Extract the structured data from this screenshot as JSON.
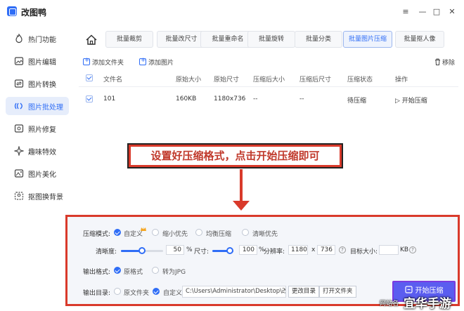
{
  "app": {
    "title": "改图鸭"
  },
  "window": {
    "menu_icon": "≡",
    "minimize_icon": "—",
    "maximize_icon": "□",
    "close_icon": "✕"
  },
  "sidebar": {
    "items": [
      {
        "label": "热门功能",
        "icon": "flame-icon"
      },
      {
        "label": "图片编辑",
        "icon": "image-edit-icon"
      },
      {
        "label": "图片转换",
        "icon": "convert-icon"
      },
      {
        "label": "图片批处理",
        "icon": "batch-icon"
      },
      {
        "label": "照片修复",
        "icon": "repair-icon"
      },
      {
        "label": "趣味特效",
        "icon": "effects-icon"
      },
      {
        "label": "图片美化",
        "icon": "beautify-icon"
      },
      {
        "label": "抠图换背景",
        "icon": "cutout-icon"
      }
    ],
    "active_index": 3
  },
  "tabs": [
    "批量裁剪",
    "批量改尺寸",
    "批量重命名",
    "批量旋转",
    "批量分类",
    "批量图片压缩",
    "批量抠人像"
  ],
  "active_tab": 5,
  "actions": {
    "add_folder": "添加文件夹",
    "add_image": "添加图片",
    "remove": "移除"
  },
  "table": {
    "headers": [
      "文件名",
      "原始大小",
      "原始尺寸",
      "压缩后大小",
      "压缩后尺寸",
      "压缩状态",
      "操作"
    ],
    "rows": [
      {
        "name": "101",
        "size": "160KB",
        "dims": "1180x736",
        "new_size": "--",
        "new_dims": "--",
        "status": "待压缩",
        "action": "▷ 开始压缩"
      }
    ]
  },
  "banner": {
    "text": "设置好压缩格式，点击开始压缩即可"
  },
  "settings": {
    "mode_label": "压缩模式:",
    "modes": [
      "自定义",
      "缩小优先",
      "均衡压缩",
      "清晰优先"
    ],
    "clarity_label": "清晰度:",
    "clarity_value": "50",
    "clarity_unit": "%",
    "clarity_fraction": 0.5,
    "size_label": "尺寸:",
    "size_value": "100",
    "size_unit": "%",
    "size_fraction": 1.0,
    "resolution_label": "分辨率:",
    "res_w": "1180",
    "res_x": "x",
    "res_h": "736",
    "target_label": "目标大小:",
    "target_value": "",
    "target_unit": "KB",
    "format_label": "输出格式:",
    "formats": [
      "原格式",
      "转为JPG"
    ],
    "dir_label": "输出目录:",
    "dirs": [
      "原文件夹",
      "自定义"
    ],
    "path": "C:\\Users\\Administrator\\Desktop\\改...",
    "change_dir": "更改目录",
    "open_folder": "打开文件夹",
    "start_button": "开始压缩"
  },
  "watermark": {
    "small": "网站名",
    "big": "宜华手游"
  }
}
